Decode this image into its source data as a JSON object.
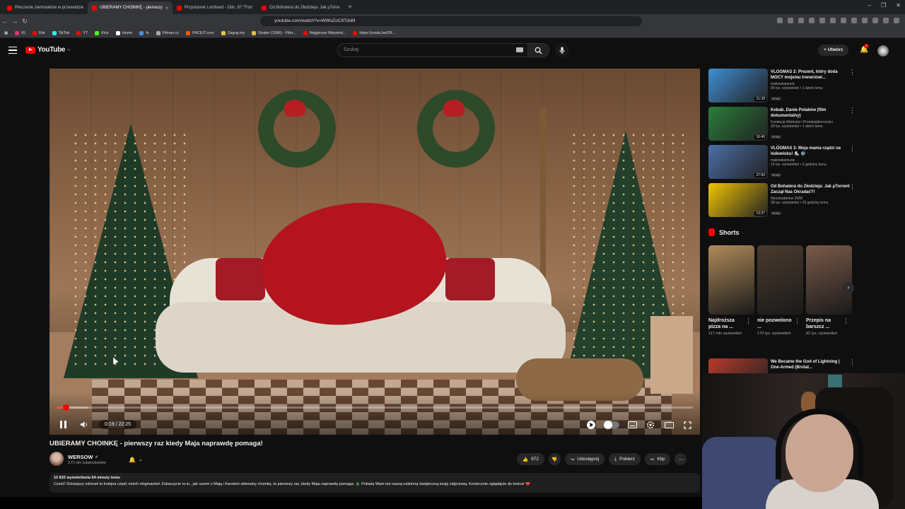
{
  "browser": {
    "tabs": [
      {
        "label": "Pieczenie ziemniaków w przewodzie"
      },
      {
        "label": "UBIERAMY CHOINKĘ - pierwszy"
      },
      {
        "label": "Przystanek Lombard - Odc. 87 \"Fort"
      },
      {
        "label": "Od Bohatera do Złodzieja: Jak µTorre"
      }
    ],
    "url": "youtube.com/watch?v=WWsZoC8TdsM",
    "bookmarks": [
      {
        "label": "IG",
        "color": "#e1306c"
      },
      {
        "label": "Rat",
        "color": "#ff0000"
      },
      {
        "label": "TikTok",
        "color": "#25f4ee"
      },
      {
        "label": "YT",
        "color": "#ff0000"
      },
      {
        "label": "Kick",
        "color": "#53fc18"
      },
      {
        "label": "Home",
        "color": "#ffffff"
      },
      {
        "label": "fx",
        "color": "#4a90d9"
      },
      {
        "label": "Filman.cc",
        "color": "#aaaaaa"
      },
      {
        "label": "FACEIT.com",
        "color": "#ff5500"
      },
      {
        "label": "Zagraj.my",
        "color": "#f0c040"
      },
      {
        "label": "Dealer (1996) - Film...",
        "color": "#e8b84a"
      },
      {
        "label": "Najgorsze Więzieni...",
        "color": "#ff0000"
      },
      {
        "label": "https://youtu.be/ZR...",
        "color": "#ff0000"
      }
    ]
  },
  "youtube": {
    "logo_text": "YouTube",
    "country": "PL",
    "search_placeholder": "Szukaj",
    "create_label": "Utwórz",
    "notification_count": "2"
  },
  "player": {
    "time": "0:19 / 22:25",
    "progress_fraction": 0.014,
    "buffer_fraction": 0.05
  },
  "video": {
    "title": "UBIERAMY CHOINKĘ - pierwszy raz kiedy Maja naprawdę pomaga!",
    "channel": "WERSOW",
    "subscribers": "2,72 mln subskrybentów",
    "likes": "972",
    "share_label": "Udostępnij",
    "download_label": "Pobierz",
    "clip_label": "Klip",
    "views_time": "10 832 wyświetlenia  54 minuty temu",
    "description": "Cześć! Dzisiejszy odcinek to kolejna część moich vlogmasów! Zobaczycie m.in., jak razem z Mają i Karolem ubieramy choinkę, to pierwszy raz, kiedy Maja naprawdę pomaga. 🎄 Pokażę Wam też naszą rodzinną świąteczną sesję zdjęciową. Koniecznie oglądajcie do końca! ❤️"
  },
  "related": [
    {
      "title": "VLOGMAS 2: Prezent, który doda MOCY mojemu treneriowi...",
      "channel": "makowkamusic",
      "meta": "90 tys. wyświetleń • 1 dzień temu",
      "badge": "Nowy",
      "duration": "21:38",
      "color": "#3e8fd1"
    },
    {
      "title": "Kebab. Danie Polaków (film dokumentalny)",
      "channel": "Fundacja Wolności i Przedsiębiorczości",
      "meta": "29 tys. wyświetleń • 1 dzień temu",
      "badge": "Nowy",
      "duration": "16:40",
      "color": "#2a7d3a"
    },
    {
      "title": "VLOGMAS 3: Moja mama rządzi na lodowisku! ⛸️ ❄️",
      "channel": "makowkamusic",
      "meta": "14 tys. wyświetleń • 2 godziny temu",
      "badge": "Nowy",
      "duration": "27:50",
      "color": "#4a6fa8"
    },
    {
      "title": "Od Bohatera do Złodzieja: Jak µTorrent Zaczął Nas Okradać?!",
      "channel": "Neostradamus 2000",
      "meta": "38 tys. wyświetleń • 23 godziny temu",
      "badge": "Nowy",
      "duration": "13:37",
      "color": "#f2c400"
    }
  ],
  "shorts": {
    "heading": "Shorts",
    "items": [
      {
        "title": "Najdroższa pizza na ...",
        "views": "117 mln wyświetleń",
        "color": "#b08a5a"
      },
      {
        "title": "nie pozwolono ...",
        "views": "170 tys. wyświetleń",
        "color": "#4a3a2e"
      },
      {
        "title": "Przepis na barszcz ...",
        "views": "82 tys. wyświetleń",
        "color": "#7a5a4a"
      }
    ]
  },
  "last_related": {
    "title": "We Became the God of Lightning | One-Armed (Brotat...",
    "color": "#b83a2a"
  }
}
